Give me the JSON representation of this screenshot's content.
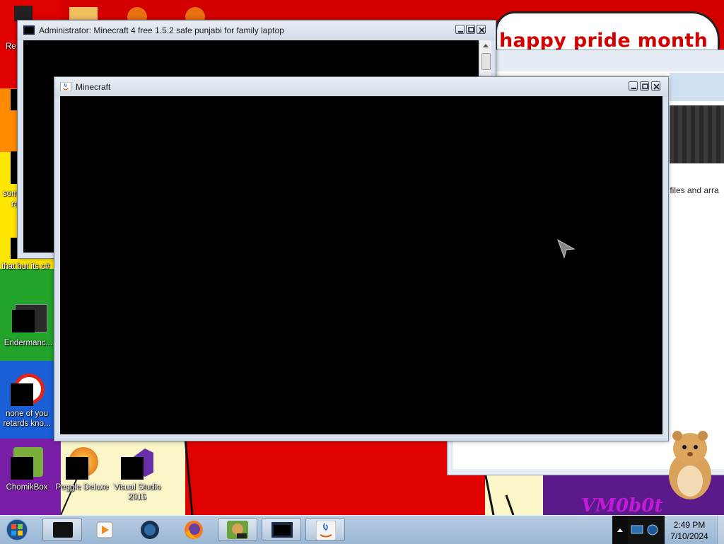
{
  "wallpaper": {
    "sign_text": "happy pride month",
    "watermark": "VM0b0t"
  },
  "desktop_icons": [
    {
      "label": "Endermanc..."
    },
    {
      "label": "none of you retards kno..."
    },
    {
      "label": "ChomikBox"
    },
    {
      "label": "Peggle Deluxe"
    },
    {
      "label": "Visual Studio 2015"
    }
  ],
  "partial_labels": {
    "top": "Re",
    "some": "som",
    "ra": "ra",
    "thatbut": "that but its c#"
  },
  "cmd_window": {
    "title": "Administrator:  Minecraft 4 free 1.5.2 safe punjabi for family laptop"
  },
  "minecraft_window": {
    "title": "Minecraft"
  },
  "background_window": {
    "partial_text": "r files and arra"
  },
  "taskbar": {
    "items": [
      {
        "icon": "black-app-icon"
      },
      {
        "icon": "media-player-icon"
      },
      {
        "icon": "globe-app-icon"
      },
      {
        "icon": "firefox-icon"
      },
      {
        "icon": "chomikbox-icon"
      },
      {
        "icon": "cmd-icon"
      },
      {
        "icon": "java-icon"
      }
    ],
    "clock": {
      "time": "2:49 PM",
      "date": "7/10/2024"
    }
  }
}
